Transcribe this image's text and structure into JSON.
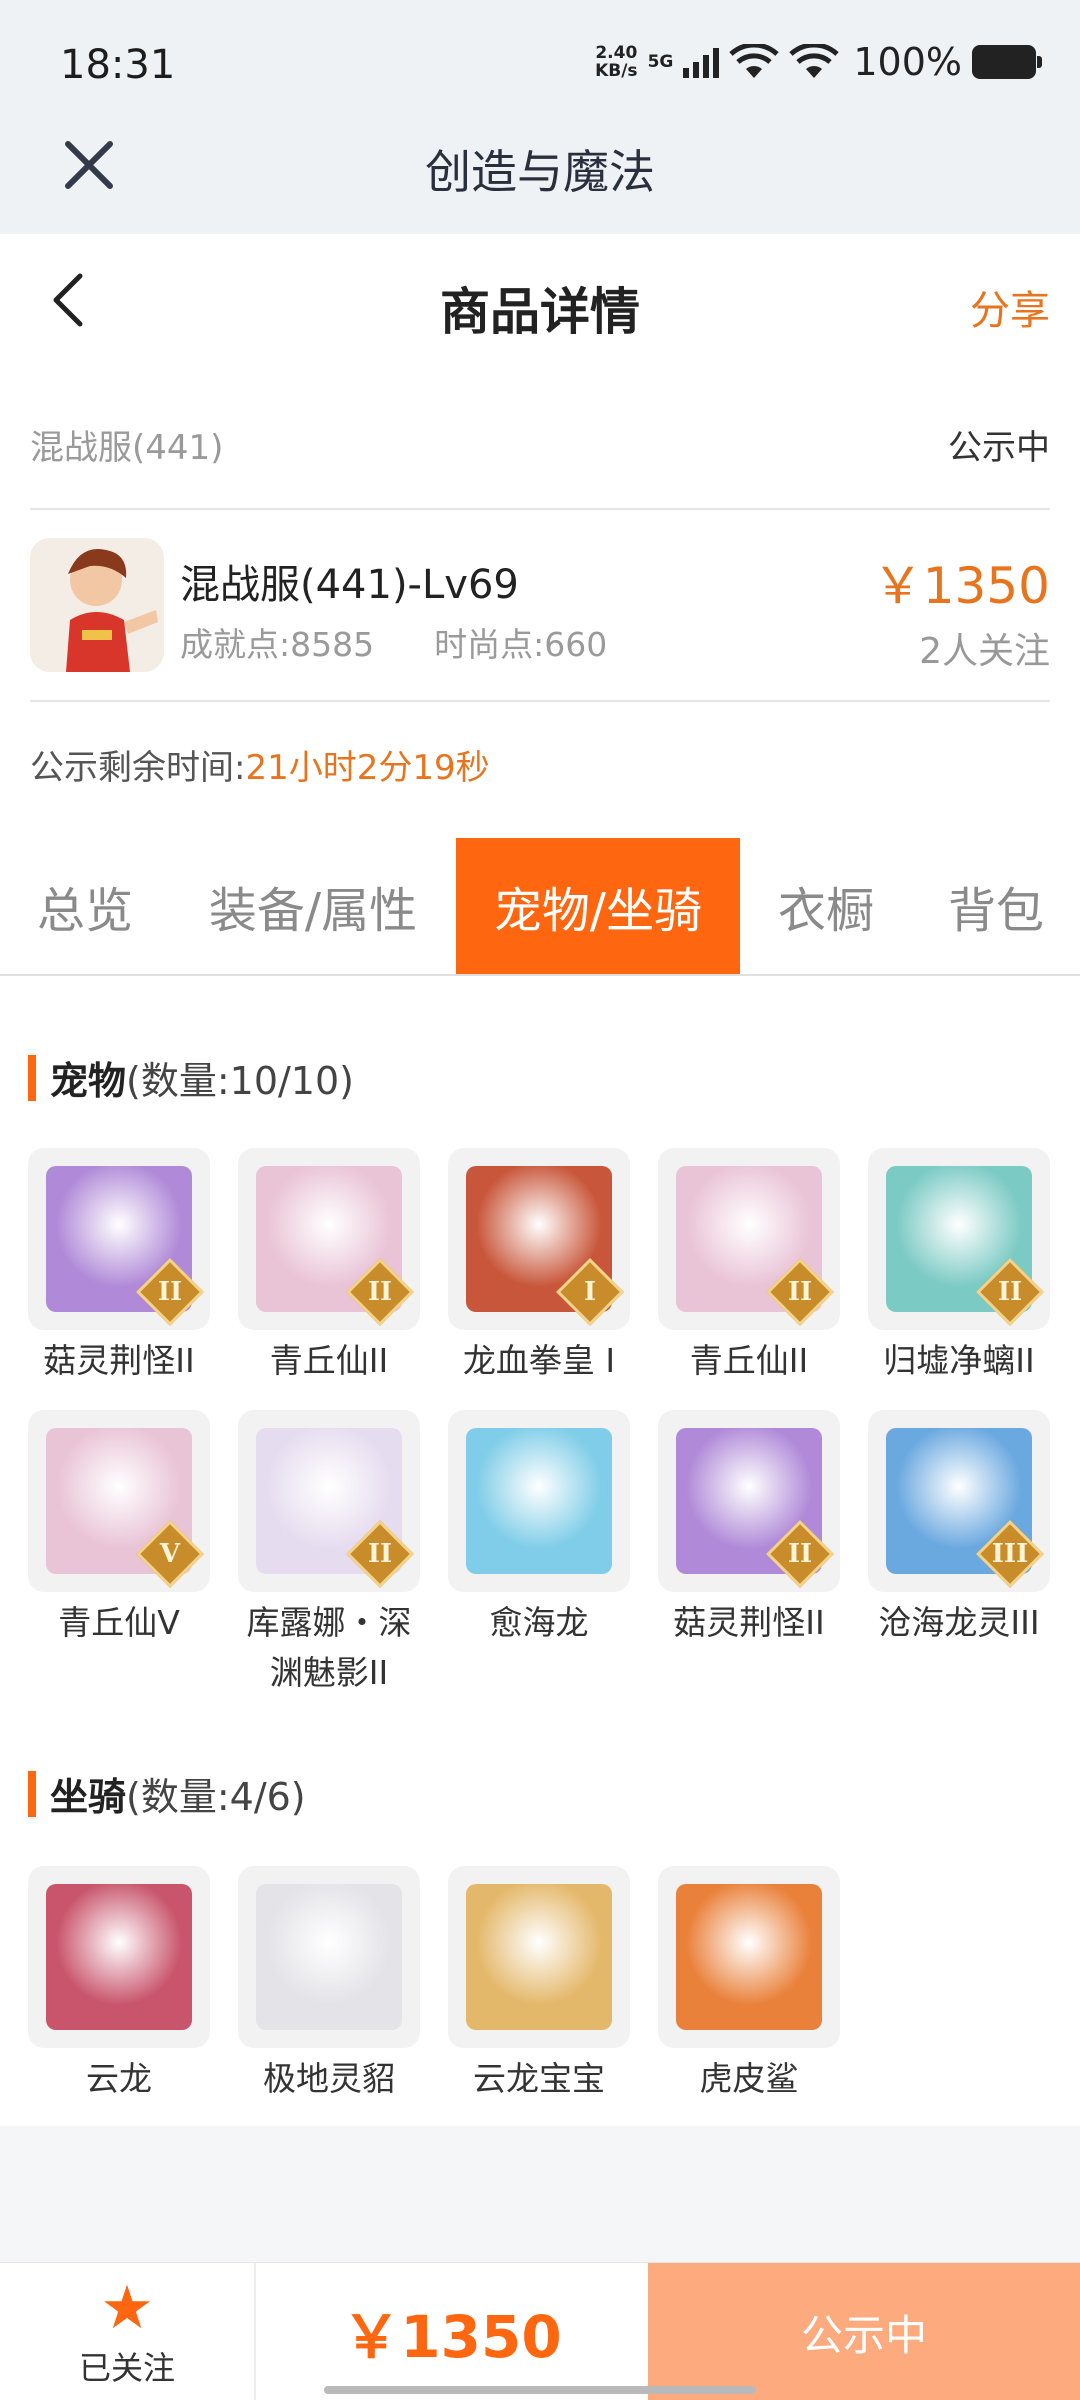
{
  "status_bar": {
    "time": "18:31",
    "speed_value": "2.40",
    "speed_unit": "KB/s",
    "network": "5G",
    "battery_pct": "100%"
  },
  "app": {
    "title": "创造与魔法",
    "close_icon": "close-icon"
  },
  "header": {
    "title": "商品详情",
    "share_label": "分享",
    "back_icon": "chevron-left-icon"
  },
  "listing": {
    "server": "混战服(441)",
    "status": "公示中",
    "name": "混战服(441)-Lv69",
    "achievement": "成就点:8585",
    "fashion": "时尚点:660",
    "price": "￥1350",
    "followers": "2人关注",
    "timer_label": "公示剩余时间:",
    "timer_value": "21小时2分19秒"
  },
  "tabs": [
    {
      "label": "总览",
      "active": false
    },
    {
      "label": "装备/属性",
      "active": false
    },
    {
      "label": "宠物/坐骑",
      "active": true
    },
    {
      "label": "衣橱",
      "active": false
    },
    {
      "label": "背包",
      "active": false
    }
  ],
  "pets": {
    "title": "宠物",
    "count": "(数量:10/10)",
    "items": [
      {
        "name": "菇灵荆怪II",
        "rank": "II",
        "color": "#b08ad8"
      },
      {
        "name": "青丘仙II",
        "rank": "II",
        "color": "#e9c3d6"
      },
      {
        "name": "龙血拳皇 I",
        "rank": "I",
        "color": "#c8563a"
      },
      {
        "name": "青丘仙II",
        "rank": "II",
        "color": "#e9c3d6"
      },
      {
        "name": "归墟净螭II",
        "rank": "II",
        "color": "#7ccac4"
      },
      {
        "name": "青丘仙V",
        "rank": "V",
        "color": "#e9c3d6"
      },
      {
        "name": "库露娜・深渊魅影II",
        "rank": "II",
        "color": "#e6dcef"
      },
      {
        "name": "愈海龙",
        "rank": "",
        "color": "#7fcde8"
      },
      {
        "name": "菇灵荆怪II",
        "rank": "II",
        "color": "#b08ad8"
      },
      {
        "name": "沧海龙灵III",
        "rank": "III",
        "color": "#6aa8e0"
      }
    ]
  },
  "mounts": {
    "title": "坐骑",
    "count": "(数量:4/6)",
    "items": [
      {
        "name": "云龙",
        "color": "#c8556c"
      },
      {
        "name": "极地灵貂",
        "color": "#e3e3e8"
      },
      {
        "name": "云龙宝宝",
        "color": "#e4b86a"
      },
      {
        "name": "虎皮鲨",
        "color": "#e9813a"
      }
    ]
  },
  "bottom": {
    "follow_label": "已关注",
    "price": "￥1350",
    "status": "公示中"
  }
}
